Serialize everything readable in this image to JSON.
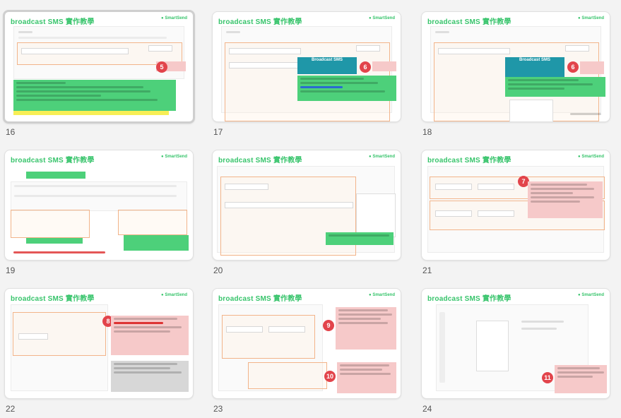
{
  "slides": [
    {
      "num": "16",
      "title": "broadcast SMS 實作教學",
      "brand": "SmartSend",
      "badge": "5",
      "selected": true
    },
    {
      "num": "17",
      "title": "broadcast SMS 實作教學",
      "brand": "SmartSend",
      "badge": "6",
      "callout": "Broadcast SMS"
    },
    {
      "num": "18",
      "title": "broadcast SMS 實作教學",
      "brand": "SmartSend",
      "badge": "6",
      "callout": "Broadcast SMS"
    },
    {
      "num": "19",
      "title": "broadcast SMS 實作教學",
      "brand": "SmartSend",
      "badge": ""
    },
    {
      "num": "20",
      "title": "broadcast SMS 實作教學",
      "brand": "SmartSend",
      "badge": ""
    },
    {
      "num": "21",
      "title": "broadcast SMS 實作教學",
      "brand": "SmartSend",
      "badge": "7"
    },
    {
      "num": "22",
      "title": "broadcast SMS 實作教學",
      "brand": "SmartSend",
      "badge": "8"
    },
    {
      "num": "23",
      "title": "broadcast SMS 實作教學",
      "brand": "SmartSend",
      "badge": "9",
      "badge2": "10"
    },
    {
      "num": "24",
      "title": "broadcast SMS 實作教學",
      "brand": "SmartSend",
      "badge": "11"
    }
  ]
}
